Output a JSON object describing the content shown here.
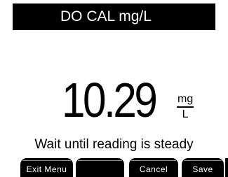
{
  "title_bar": {
    "title": "DO CAL mg/L"
  },
  "reading": {
    "value": "10.29",
    "unit_numerator": "mg",
    "unit_denominator": "L"
  },
  "status": {
    "message": "Wait until reading is steady"
  },
  "softkeys": [
    {
      "label": "Exit Menu"
    },
    {
      "label": ""
    },
    {
      "label": "Cancel"
    },
    {
      "label": "Save"
    }
  ],
  "colors": {
    "background": "#ffffff",
    "foreground": "#000000",
    "inverse_text": "#ffffff"
  }
}
